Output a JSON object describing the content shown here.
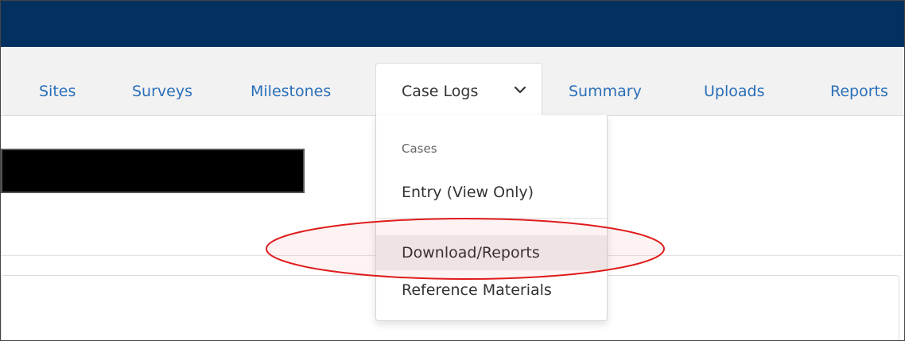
{
  "colors": {
    "topbar": "#03305f",
    "nav_link": "#2a6fb8",
    "annotation": "#e01b1b"
  },
  "nav": {
    "items": [
      {
        "label": "Sites"
      },
      {
        "label": "Surveys"
      },
      {
        "label": "Milestones"
      },
      {
        "label": "Case Logs"
      },
      {
        "label": "Summary"
      },
      {
        "label": "Uploads"
      },
      {
        "label": "Reports"
      }
    ],
    "active_icon": "chevron-down-icon"
  },
  "dropdown": {
    "header": "Cases",
    "items": [
      {
        "label": "Entry (View Only)"
      },
      {
        "label": "Download/Reports"
      },
      {
        "label": "Reference Materials"
      }
    ]
  }
}
